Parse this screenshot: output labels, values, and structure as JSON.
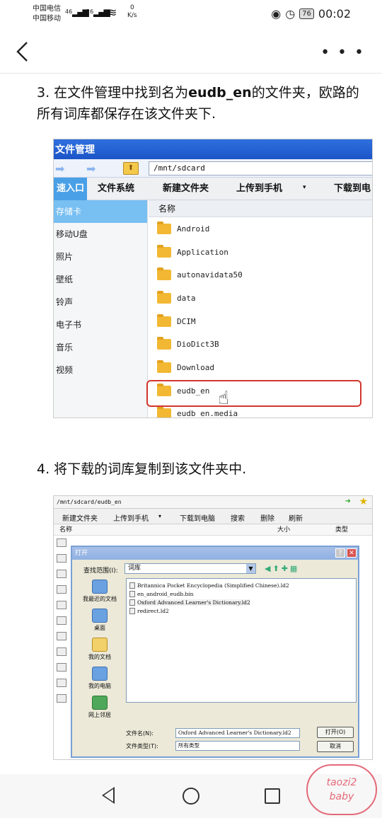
{
  "status_bar": {
    "carrier1": "中国电信",
    "carrier2": "中国移动",
    "sig1": "46",
    "sig2": "26",
    "speed_value": "0",
    "speed_unit": "K/s",
    "battery": "76",
    "time": "00:02"
  },
  "nav": {
    "more": "• • •"
  },
  "step3": {
    "prefix": "3. 在文件管理中找到名为",
    "bold": "eudb_en",
    "suffix": "的文件夹，欧路的所有词库都保存在该文件夹下."
  },
  "shot1": {
    "window_title": "文件管理",
    "path": "/mnt/sdcard",
    "tabs": [
      "速入口",
      "文件系统",
      "新建文件夹",
      "上传到手机",
      "下载到电"
    ],
    "sidebar": [
      "存储卡",
      "移动U盘",
      "照片",
      "壁纸",
      "铃声",
      "电子书",
      "音乐",
      "视频"
    ],
    "column_name": "名称",
    "folders": [
      "Android",
      "Application",
      "autonavidata50",
      "data",
      "DCIM",
      "DioDict3B",
      "Download",
      "eudb_en",
      "eudb_en.media"
    ]
  },
  "step4": {
    "text": "4. 将下载的词库复制到该文件夹中."
  },
  "shot2": {
    "address": "/mnt/sdcard/eudb_en",
    "toolbar": [
      "新建文件夹",
      "上传到手机",
      "下载到电脑",
      "搜索",
      "删除",
      "刷新"
    ],
    "col_name": "名称",
    "col_size": "大小",
    "col_type": "类型",
    "dialog_title": "打开",
    "look_in_label": "查找范围(I):",
    "look_in_value": "词库",
    "places": [
      "我最近的文档",
      "桌面",
      "我的文档",
      "我的电脑",
      "网上邻居"
    ],
    "files": [
      "Britannica Pocket Encyclopedia (Simplified Chinese).ld2",
      "en_android_eudb.bin",
      "Oxford Advanced Learner's Dictionary.ld2",
      "redirect.ld2"
    ],
    "filename_label": "文件名(N):",
    "filename_value": "Oxford Advanced Learner's Dictionary.ld2",
    "filetype_label": "文件类型(T):",
    "filetype_value": "所有类型",
    "open_button": "打开(O)",
    "cancel_button": "取消"
  },
  "watermark": {
    "line1": "taozi2",
    "line2": "baby"
  }
}
